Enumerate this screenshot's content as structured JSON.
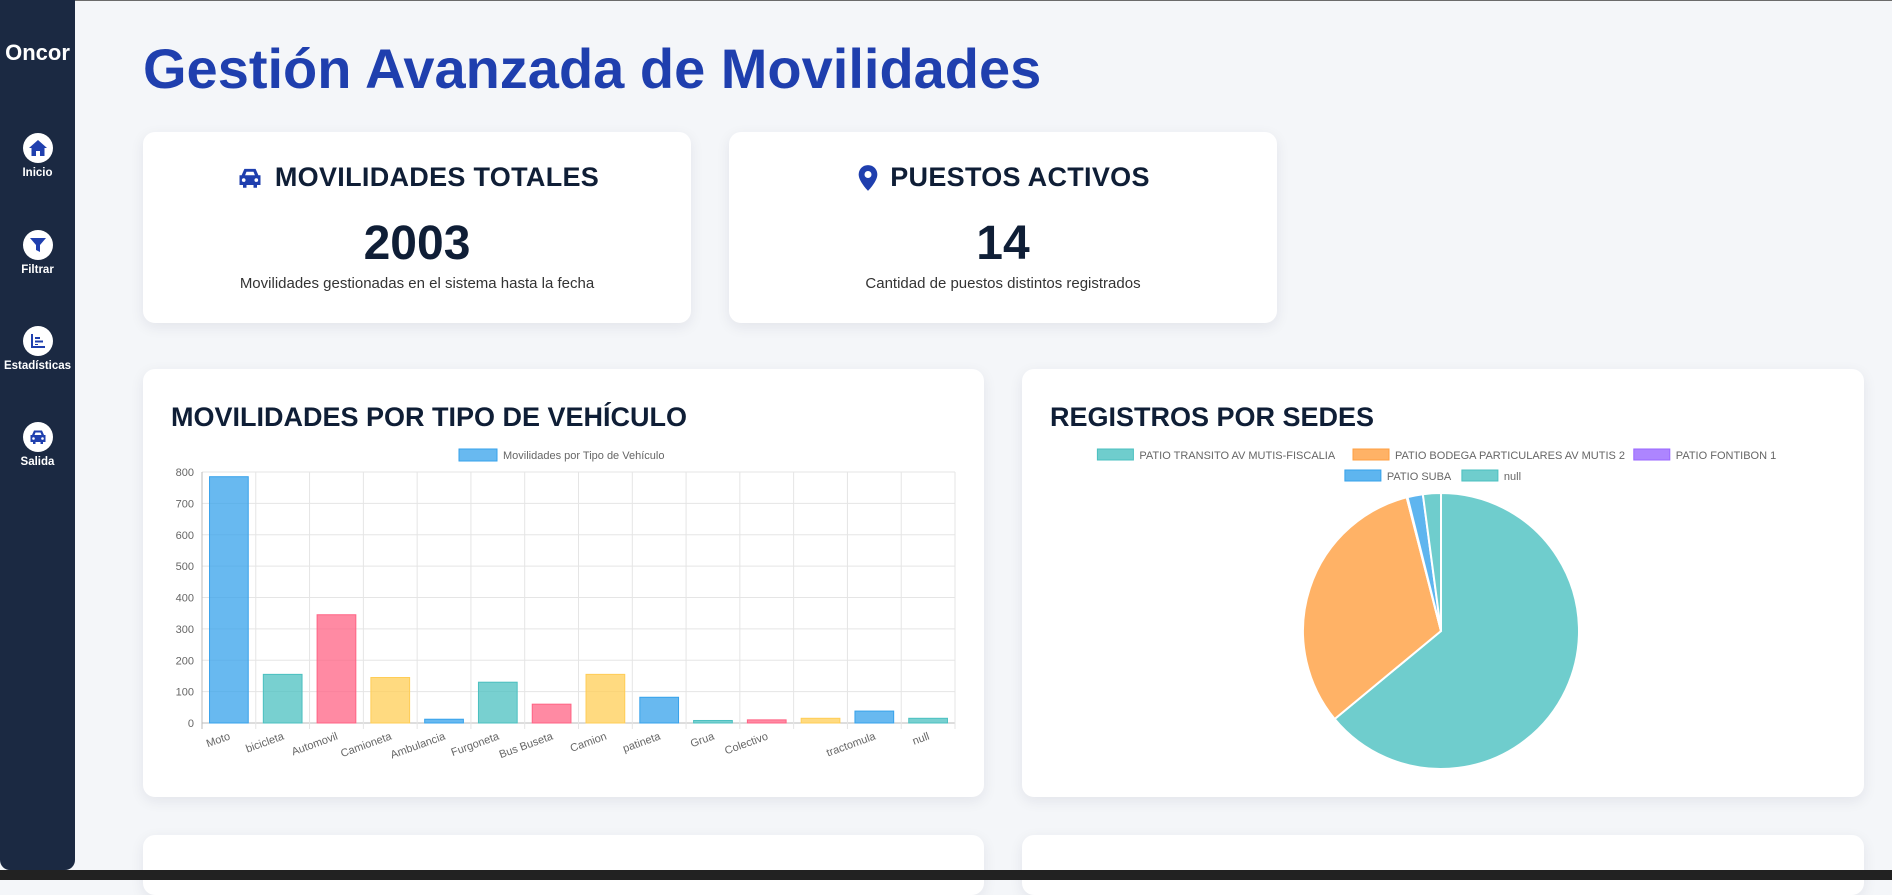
{
  "sidebar": {
    "brand": "Oncor",
    "items": [
      {
        "label": "Inicio",
        "icon": "home-icon"
      },
      {
        "label": "Filtrar",
        "icon": "filter-icon"
      },
      {
        "label": "Estadísticas",
        "icon": "stats-icon"
      },
      {
        "label": "Salida",
        "icon": "car-icon"
      }
    ]
  },
  "header": {
    "title": "Gestión Avanzada de Movilidades"
  },
  "stats": {
    "total": {
      "title": "MOVILIDADES TOTALES",
      "value": "2003",
      "description": "Movilidades gestionadas en el sistema hasta la fecha",
      "icon": "car-icon"
    },
    "active": {
      "title": "PUESTOS ACTIVOS",
      "value": "14",
      "description": "Cantidad de puestos distintos registrados",
      "icon": "location-pin-icon"
    }
  },
  "colors": {
    "accent": "#1f3fae",
    "sidebar": "#1b2942",
    "blue": "#36a2eb",
    "teal": "#4bc0c0",
    "pink": "#ff6384",
    "yellow": "#ffcd56",
    "orange": "#ff9f40",
    "purple": "#9966ff"
  },
  "chart_data": [
    {
      "type": "bar",
      "title": "MOVILIDADES POR TIPO DE VEHÍCULO",
      "categories": [
        "Moto",
        "bicicleta",
        "Automovil",
        "Camioneta",
        "Ambulancia",
        "Furgoneta",
        "Bus Buseta",
        "Camion",
        "patineta",
        "Grua",
        "Colectivo",
        "",
        "tractomula",
        "null"
      ],
      "series": [
        {
          "name": "Movilidades por Tipo de Vehículo",
          "values": [
            785,
            155,
            345,
            145,
            12,
            130,
            60,
            155,
            82,
            8,
            10,
            15,
            38,
            15
          ]
        }
      ],
      "bar_colors": [
        "#36a2eb",
        "#4bc0c0",
        "#ff6384",
        "#ffcd56",
        "#36a2eb",
        "#4bc0c0",
        "#ff6384",
        "#ffcd56",
        "#36a2eb",
        "#4bc0c0",
        "#ff6384",
        "#ffcd56",
        "#36a2eb",
        "#4bc0c0"
      ],
      "ylim": [
        0,
        800
      ],
      "yticks": [
        0,
        100,
        200,
        300,
        400,
        500,
        600,
        700,
        800
      ],
      "grid": true,
      "legend": "top"
    },
    {
      "type": "pie",
      "title": "REGISTROS POR SEDES",
      "labels": [
        "PATIO TRANSITO AV MUTIS-FISCALIA",
        "PATIO BODEGA PARTICULARES AV MUTIS 2",
        "PATIO FONTIBON 1",
        "PATIO SUBA",
        "null"
      ],
      "values": [
        64,
        32,
        0.1,
        1.8,
        2.1
      ],
      "colors": [
        "#4bc0c0",
        "#ff9f40",
        "#9966ff",
        "#36a2eb",
        "#4bc0c0"
      ],
      "legend": "top"
    }
  ]
}
